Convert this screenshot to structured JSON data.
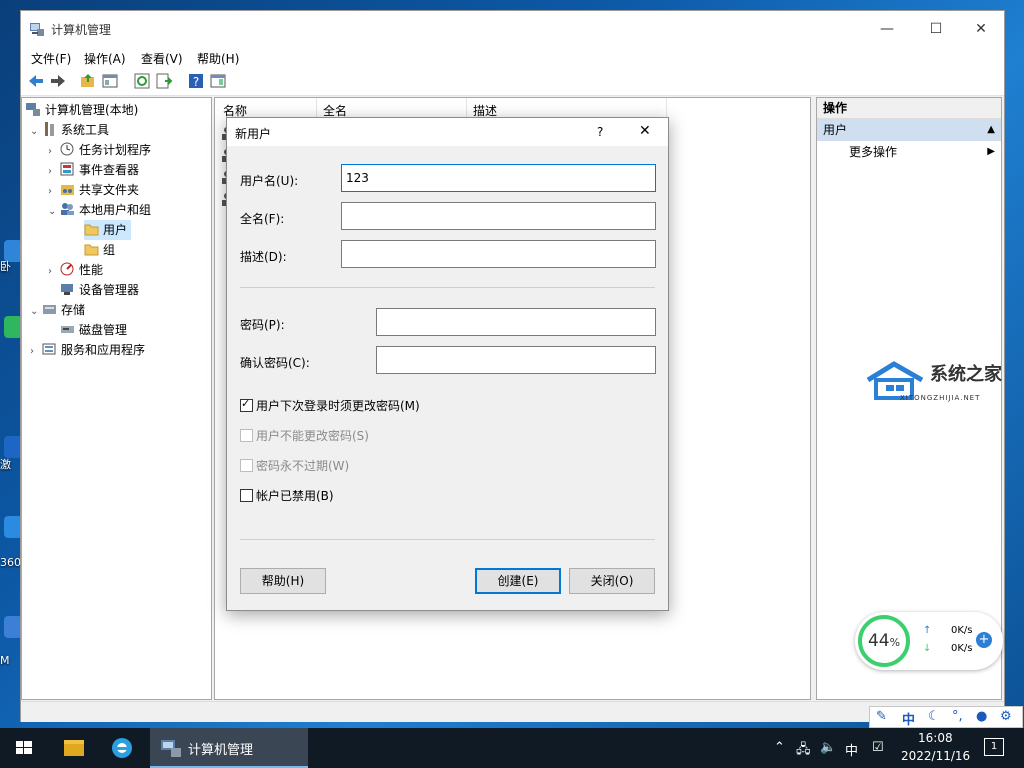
{
  "desktop": {
    "labels": [
      "卧",
      "激",
      "360",
      "M"
    ]
  },
  "window": {
    "title": "计算机管理",
    "controls": {
      "minimize": "—",
      "maximize": "☐",
      "close": "✕"
    },
    "menu": [
      "文件(F)",
      "操作(A)",
      "查看(V)",
      "帮助(H)"
    ],
    "toolbar_icons": [
      "back-arrow-icon",
      "forward-arrow-icon",
      "up-folder-icon",
      "console-tree-icon",
      "refresh-icon",
      "export-list-icon",
      "help-icon",
      "show-hide-icon"
    ]
  },
  "tree": {
    "items": [
      {
        "label": "计算机管理(本地)",
        "icon": "computer-management-icon"
      },
      {
        "label": "系统工具",
        "icon": "tools-icon",
        "arrow": "⌄"
      },
      {
        "label": "任务计划程序",
        "icon": "clock-icon",
        "arrow": "›"
      },
      {
        "label": "事件查看器",
        "icon": "event-viewer-icon",
        "arrow": "›"
      },
      {
        "label": "共享文件夹",
        "icon": "shared-folder-icon",
        "arrow": "›"
      },
      {
        "label": "本地用户和组",
        "icon": "users-group-icon",
        "arrow": "⌄"
      },
      {
        "label": "用户",
        "icon": "folder-icon",
        "selected": true
      },
      {
        "label": "组",
        "icon": "folder-icon"
      },
      {
        "label": "性能",
        "icon": "performance-icon",
        "arrow": "›"
      },
      {
        "label": "设备管理器",
        "icon": "device-manager-icon"
      },
      {
        "label": "存储",
        "icon": "storage-icon",
        "arrow": "⌄"
      },
      {
        "label": "磁盘管理",
        "icon": "disk-icon"
      },
      {
        "label": "服务和应用程序",
        "icon": "services-icon",
        "arrow": "›"
      }
    ]
  },
  "list": {
    "columns": [
      "名称",
      "全名",
      "描述"
    ]
  },
  "actions": {
    "header": "操作",
    "section": "用户",
    "more": "更多操作"
  },
  "dialog": {
    "title": "新用户",
    "help_glyph": "?",
    "close_glyph": "✕",
    "username_label": "用户名(U):",
    "username_value": "123",
    "fullname_label": "全名(F):",
    "fullname_value": "",
    "description_label": "描述(D):",
    "description_value": "",
    "password_label": "密码(P):",
    "confirm_label": "确认密码(C):",
    "checkboxes": [
      {
        "label": "用户下次登录时须更改密码(M)",
        "checked": true,
        "disabled": false
      },
      {
        "label": "用户不能更改密码(S)",
        "checked": false,
        "disabled": true
      },
      {
        "label": "密码永不过期(W)",
        "checked": false,
        "disabled": true
      },
      {
        "label": "帐户已禁用(B)",
        "checked": false,
        "disabled": false
      }
    ],
    "help_button": "帮助(H)",
    "create_button": "创建(E)",
    "close_button": "关闭(O)"
  },
  "watermark": {
    "title": "系统之家",
    "subtitle": "XITONGZHIJIA.NET"
  },
  "network_widget": {
    "percent": "44",
    "percent_sign": "%",
    "upload": "0K/s",
    "download": "0K/s",
    "add": "+"
  },
  "ime_bar": {
    "items": [
      "中"
    ]
  },
  "taskbar": {
    "app_label": "计算机管理",
    "tray_ime": "中",
    "time": "16:08",
    "date": "2022/11/16",
    "notification_count": "1"
  },
  "colors": {
    "selection": "#cce8ff",
    "accent": "#0078d7",
    "annotation_arrow": "#e8362c",
    "widget_ring": "#3ccf6e"
  }
}
